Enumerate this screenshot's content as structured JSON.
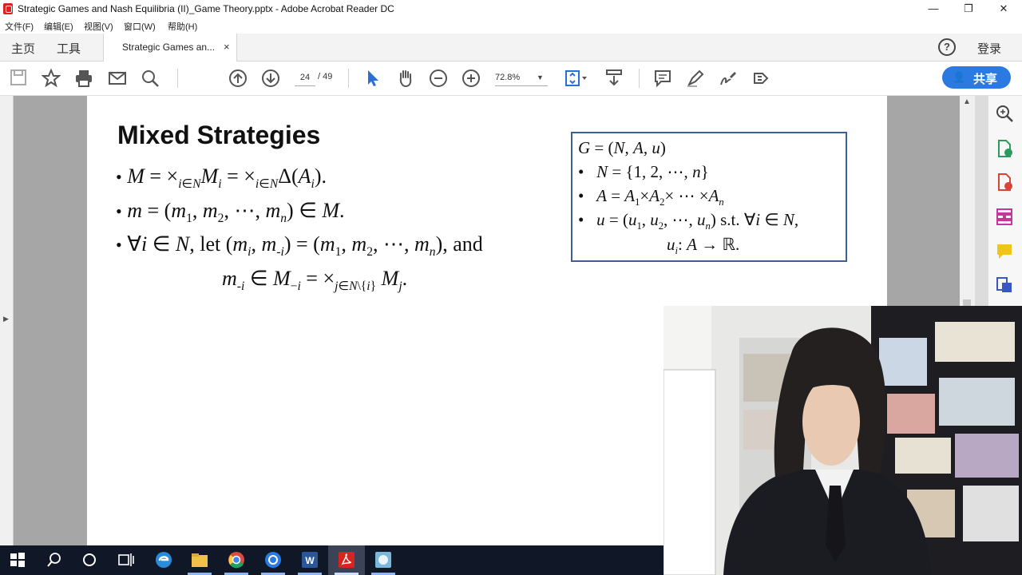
{
  "window": {
    "title": "Strategic Games and Nash Equilibria (II)_Game Theory.pptx - Adobe Acrobat Reader DC",
    "minimize": "—",
    "restore": "❐",
    "close": "✕"
  },
  "menu": [
    "文件(F)",
    "编辑(E)",
    "视图(V)",
    "窗口(W)",
    "帮助(H)"
  ],
  "nav": {
    "home": "主页",
    "tools": "工具",
    "tab_label": "Strategic Games an...",
    "tab_close": "×",
    "help": "?",
    "login": "登录"
  },
  "toolbar": {
    "icons": [
      "save-icon",
      "bookmark-star-icon",
      "print-icon",
      "email-icon",
      "search-icon",
      "page-up-icon",
      "page-down-icon",
      "select-cursor-icon",
      "hand-tool-icon",
      "zoom-out-icon",
      "zoom-in-icon",
      "fit-page-icon",
      "scroll-mode-icon",
      "comment-icon",
      "highlight-pen-icon",
      "sign-icon",
      "stamp-icon"
    ],
    "page_current": "24",
    "page_total": "/ 49",
    "zoom": "72.8%",
    "share_label": "共享"
  },
  "slide": {
    "title": "Mixed Strategies",
    "bullets_symbol": "•",
    "box_lines": [
      "G = (N, A, u)",
      "N = {1, 2, ⋯, n}",
      "A = A1×A2× ⋯ ×An",
      "u = (u1, u2, ⋯, un) s.t. ∀i ∈ N,",
      "ui: A → ℝ."
    ]
  },
  "right_sidebar": [
    "zoom-pane-icon",
    "export-pdf-icon",
    "create-pdf-icon",
    "organize-pages-icon",
    "comment-pane-icon",
    "send-file-icon"
  ],
  "taskbar": {
    "apps": [
      "windows-start-icon",
      "search-icon",
      "cortana-icon",
      "task-view-icon",
      "edge-icon",
      "file-explorer-icon",
      "chrome-icon",
      "mail-icon",
      "word-icon",
      "acrobat-icon",
      "photos-icon"
    ]
  },
  "colors": {
    "accent": "#2a7ae2",
    "box_border": "#3b5f9a",
    "gutter": "#a6a6a6",
    "taskbar": "#101828"
  }
}
